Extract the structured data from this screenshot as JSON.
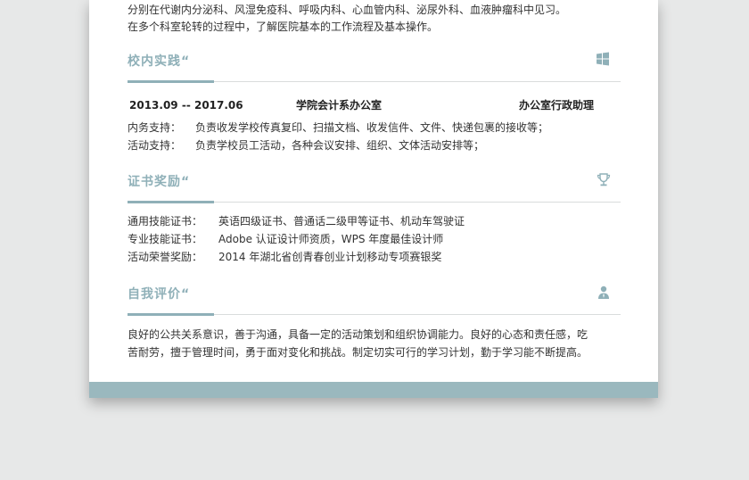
{
  "intro": {
    "line1": "分别在代谢内分泌科、风湿免疫科、呼吸内科、心血管内科、泌尿外科、血液肿瘤科中见习。",
    "line2": "在多个科室轮转的过程中，了解医院基本的工作流程及基本操作。"
  },
  "practice": {
    "title": "校内实践",
    "quote": "“",
    "icon": "windows-icon",
    "period": "2013.09 -- 2017.06",
    "org": "学院会计系办公室",
    "role": "办公室行政助理",
    "items": [
      {
        "label": "内务支持：",
        "value": "负责收发学校传真复印、扫描文档、收发信件、文件、快递包裹的接收等；"
      },
      {
        "label": "活动支持：",
        "value": "负责学校员工活动，各种会议安排、组织、文体活动安排等；"
      }
    ]
  },
  "certificates": {
    "title": "证书奖励",
    "quote": "“",
    "icon": "trophy-icon",
    "items": [
      {
        "label": "通用技能证书：",
        "value": "英语四级证书、普通话二级甲等证书、机动车驾驶证"
      },
      {
        "label": "专业技能证书：",
        "value": "Adobe 认证设计师资质，WPS 年度最佳设计师"
      },
      {
        "label": "活动荣誉奖励：",
        "value": "2014 年湖北省创青春创业计划移动专项赛银奖"
      }
    ]
  },
  "evaluation": {
    "title": "自我评价",
    "quote": "“",
    "icon": "person-icon",
    "line1": "良好的公共关系意识，善于沟通，具备一定的活动策划和组织协调能力。良好的心态和责任感，吃",
    "line2": "苦耐劳，擅于管理时间，勇于面对变化和挑战。制定切实可行的学习计划，勤于学习能不断提高。"
  },
  "colors": {
    "accent": "#8fb0b8",
    "band": "#9ab8be",
    "background": "#e7e8e8"
  }
}
